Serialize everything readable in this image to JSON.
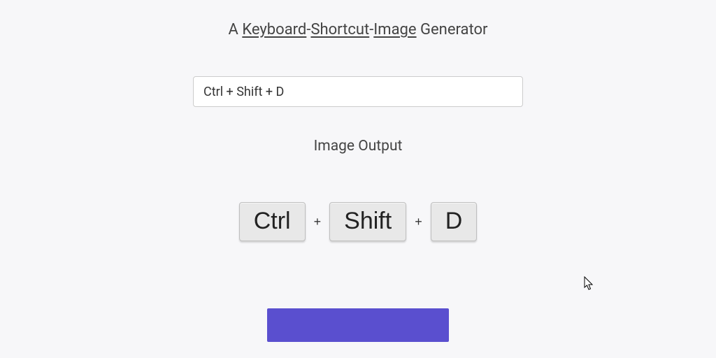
{
  "subtitle": {
    "prefix": "A ",
    "word1": "Keyboard",
    "sep1": "-",
    "word2": "Shortcut",
    "sep2": "-",
    "word3": "Image",
    "suffix": " Generator"
  },
  "input": {
    "value": "Ctrl + Shift + D"
  },
  "output_label": "Image Output",
  "keys": {
    "k1": "Ctrl",
    "k2": "Shift",
    "k3": "D"
  },
  "plus": "+",
  "colors": {
    "accent": "#5a4fcf"
  }
}
